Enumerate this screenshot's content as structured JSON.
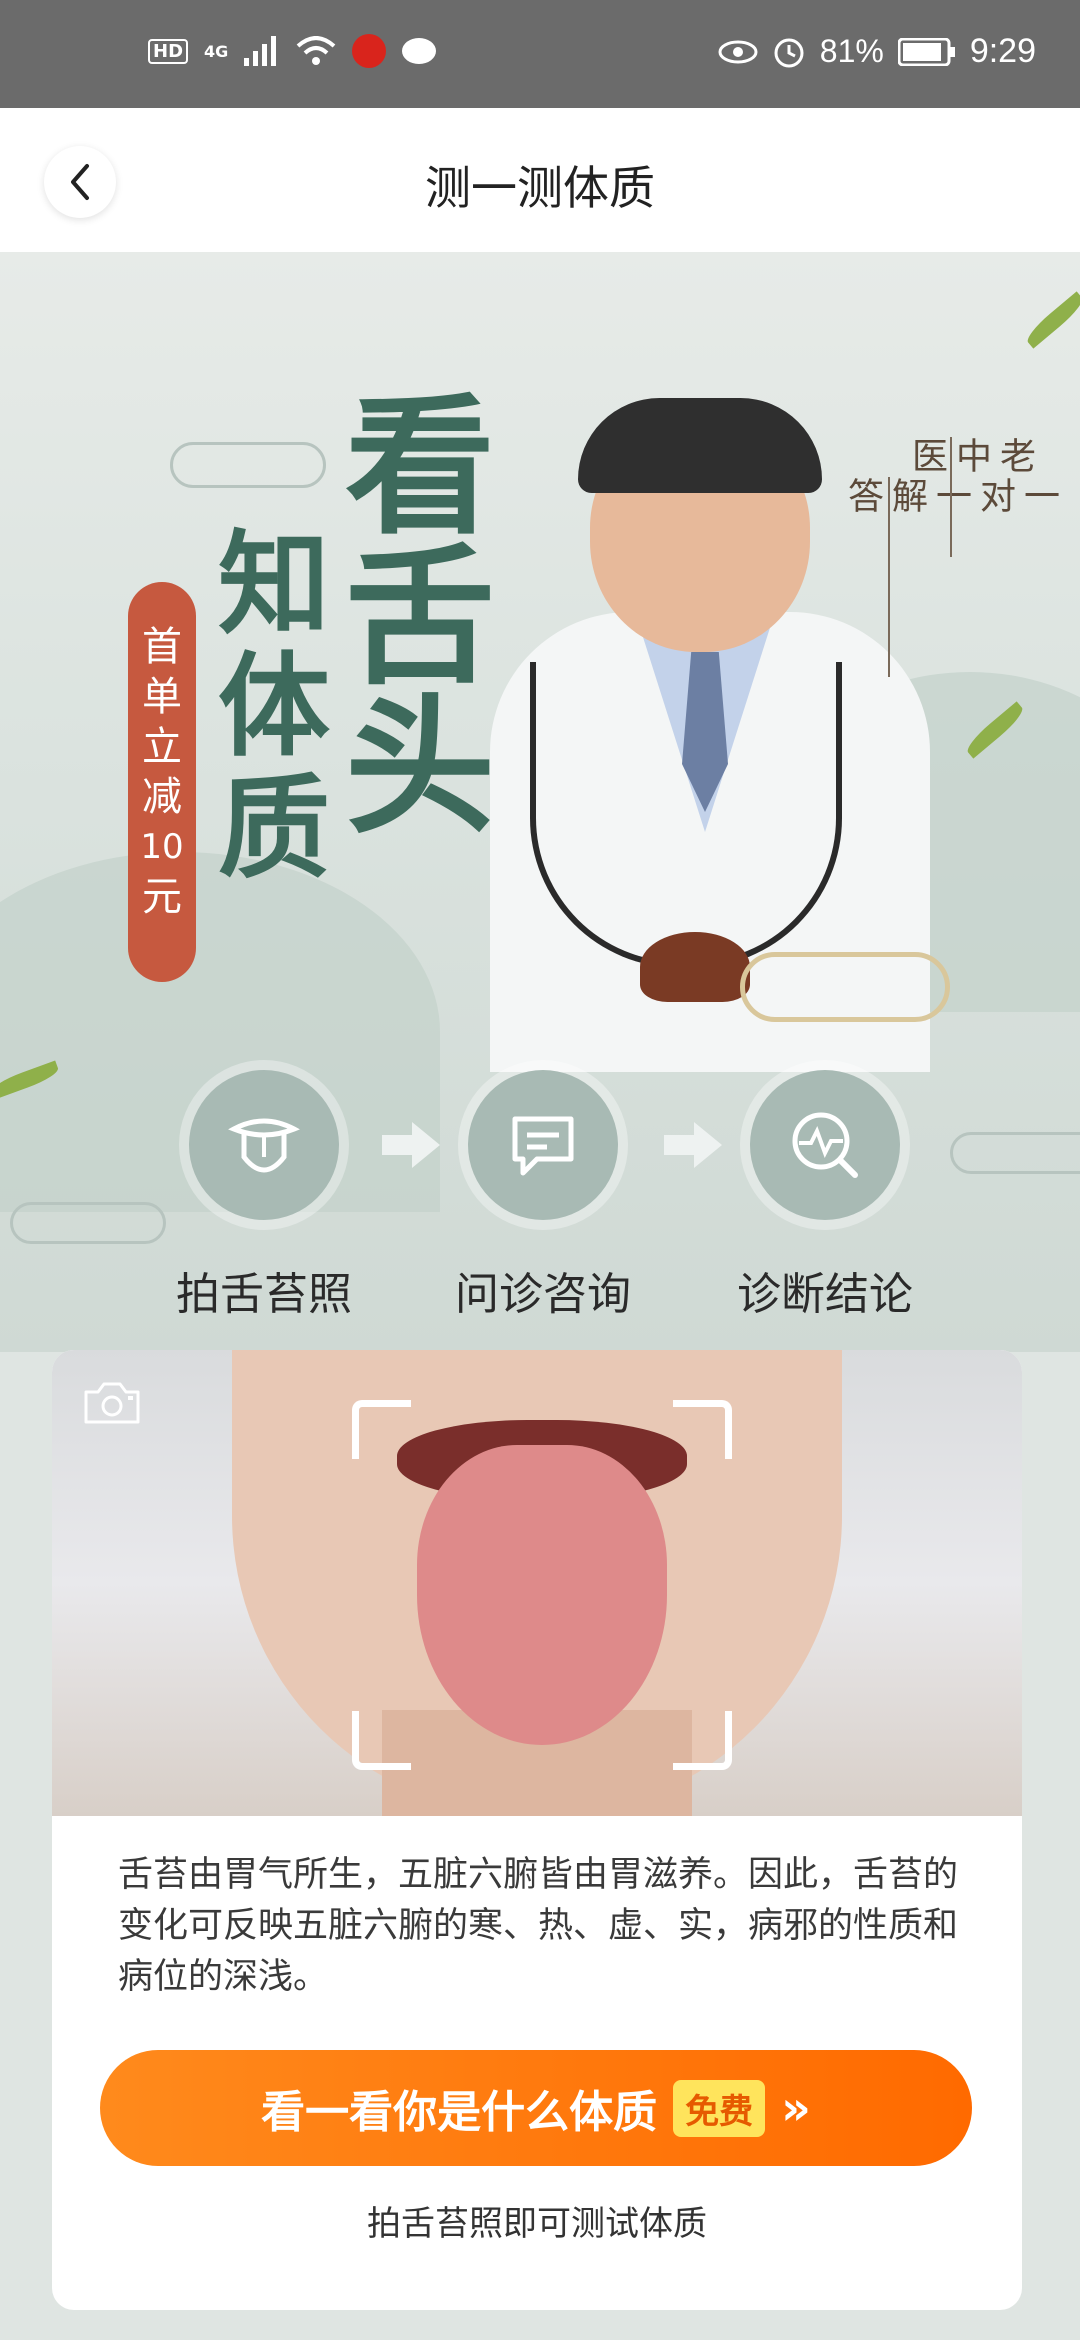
{
  "status_bar": {
    "hd": "HD",
    "network": "4G",
    "battery": "81%",
    "time": "9:29"
  },
  "header": {
    "title": "测一测体质"
  },
  "banner": {
    "title_main": "看舌头",
    "title_sub": "知体质",
    "promo": [
      "首",
      "单",
      "立",
      "减",
      "10",
      "元"
    ],
    "side_caption_top": "老中医",
    "side_caption_bottom": "一对一解答"
  },
  "steps": [
    {
      "label": "拍舌苔照",
      "icon": "tongue-icon"
    },
    {
      "label": "问诊咨询",
      "icon": "chat-icon"
    },
    {
      "label": "诊断结论",
      "icon": "diagnosis-icon"
    }
  ],
  "card": {
    "description": "舌苔由胃气所生，五脏六腑皆由胃滋养。因此，舌苔的变化可反映五脏六腑的寒、热、虚、实，病邪的性质和病位的深浅。",
    "cta_label": "看一看你是什么体质",
    "cta_badge": "免费",
    "cta_arrows": "»",
    "subtext": "拍舌苔照即可测试体质"
  },
  "colors": {
    "accent_orange": "#ff7a10",
    "title_green": "#3d6a5c",
    "promo_red": "#c6593f"
  }
}
